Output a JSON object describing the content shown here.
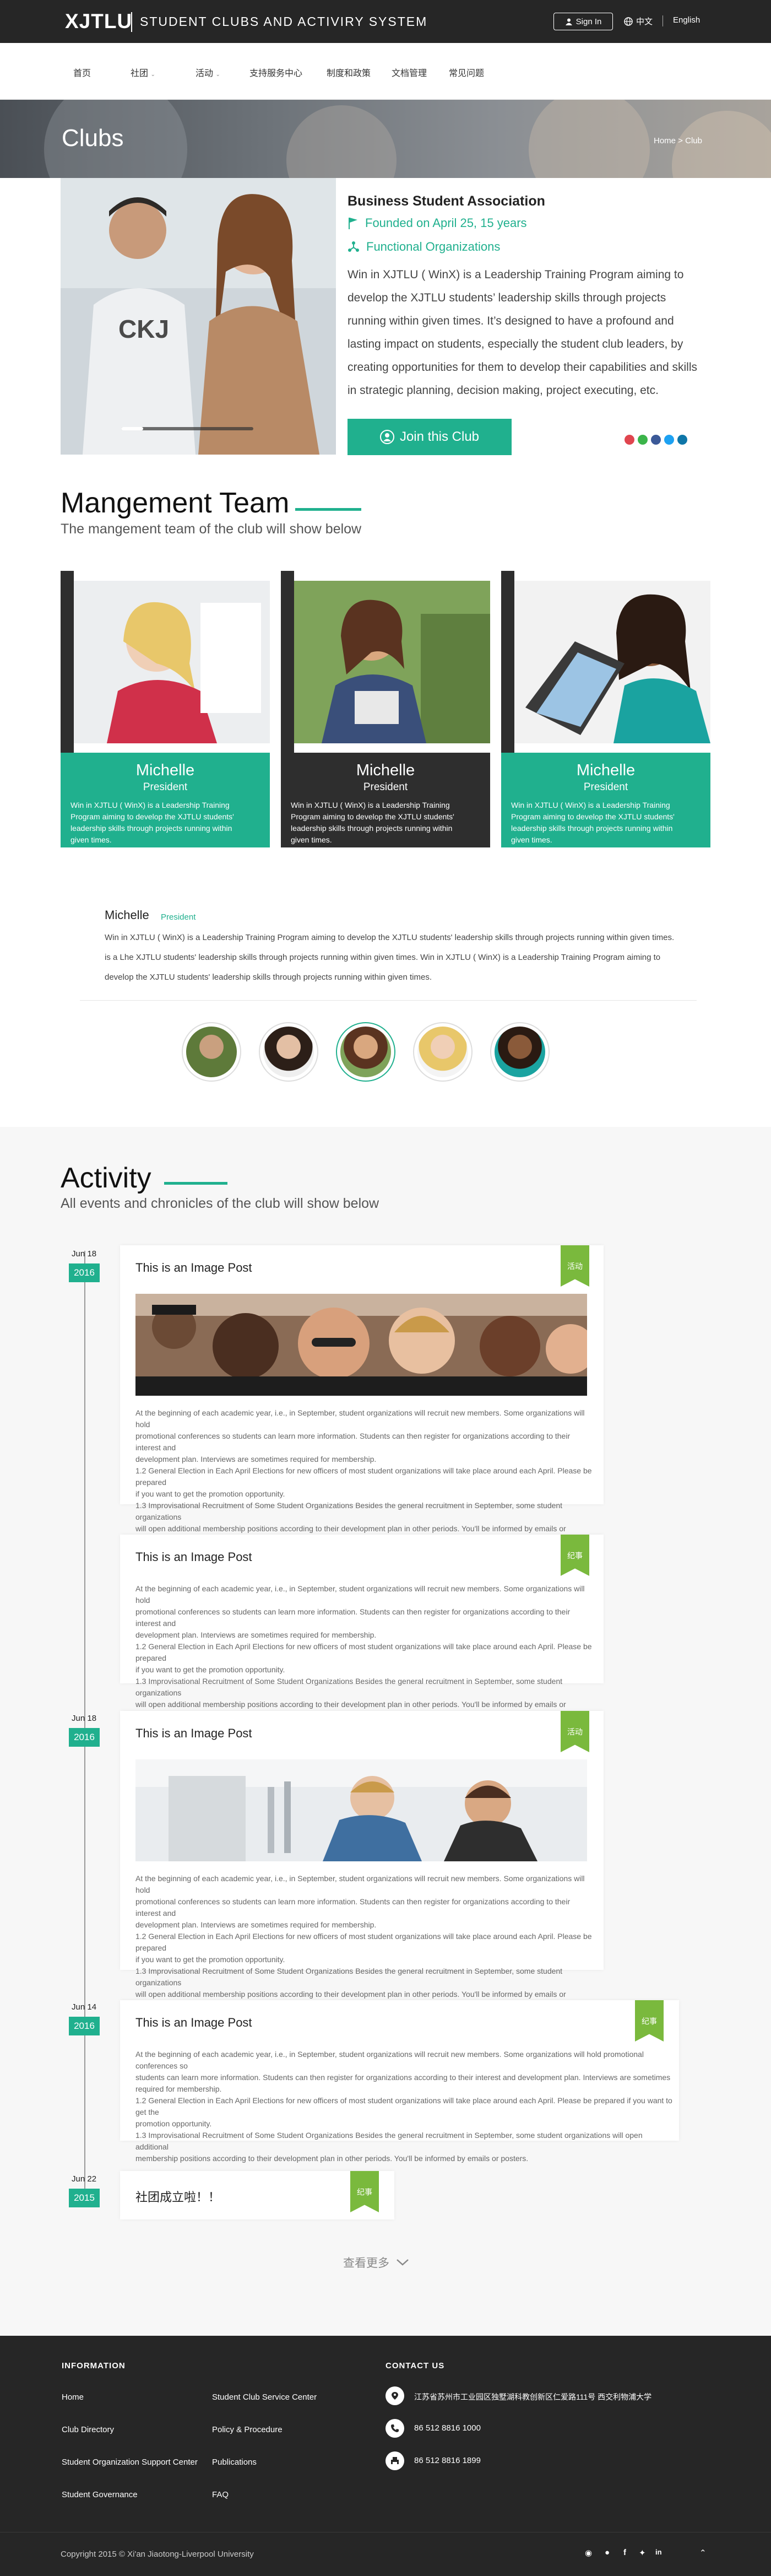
{
  "header": {
    "logo": "XJTLU",
    "system_title": "STUDENT CLUBS AND ACTIVIRY SYSTEM",
    "signin_label": "Sign In",
    "lang_zh": "中文",
    "lang_en": "English"
  },
  "nav": [
    "首页",
    "社团",
    "活动",
    "支持服务中心",
    "制度和政策",
    "文档管理",
    "常见问题"
  ],
  "hero": {
    "title": "Clubs",
    "breadcrumb": "Home > Club"
  },
  "club": {
    "name": "Business Student Association",
    "founded": "Founded on April 25, 15 years",
    "category": "Functional Organizations",
    "description": "Win in XJTLU ( WinX) is a Leadership Training Program aiming to develop the XJTLU students’ leadership skills through projects running within given times. It’s designed to have a profound and lasting impact on students, especially the student club leaders, by creating opportunities for them to develop their capabilities and skills in strategic planning, decision making, project executing, etc.",
    "join_label": "Join this Club"
  },
  "team": {
    "title": "Mangement Team",
    "subtitle": "The mangement team of the club will show below",
    "members": [
      {
        "name": "Michelle",
        "role": "President",
        "text": "Win in XJTLU ( WinX) is a Leadership Training Program aiming to develop the XJTLU students' leadership skills through projects running within given times."
      },
      {
        "name": "Michelle",
        "role": "President",
        "text": "Win in XJTLU ( WinX) is a Leadership Training Program aiming to develop the XJTLU students' leadership skills through projects running within given times."
      },
      {
        "name": "Michelle",
        "role": "President",
        "text": "Win in XJTLU ( WinX) is a Leadership Training Program aiming to develop the XJTLU students' leadership skills through projects running within given times."
      }
    ],
    "detail": {
      "name": "Michelle",
      "role": "President",
      "lines": [
        "Win in XJTLU ( WinX) is a Leadership Training Program aiming to develop the XJTLU students' leadership skills through projects running within given times.",
        "is a Lhe XJTLU students' leadership skills through projects running within given times. Win in XJTLU ( WinX) is a Leadership Training Program aiming to",
        "develop the XJTLU students' leadership skills through projects running within given times."
      ]
    }
  },
  "activity": {
    "title": "Activity",
    "subtitle": "All events and chronicles of the club will show below",
    "entries": [
      {
        "date": "Jun 18",
        "year": "2016",
        "title": "This is an Image Post",
        "tag": "活动",
        "text": [
          "At the beginning of each academic year, i.e., in September, student organizations will recruit new members. Some organizations will hold",
          "promotional conferences so students can learn more information. Students can then register for organizations according to their interest and",
          "development plan. Interviews are sometimes required for membership.",
          "1.2 General Election in Each April Elections for new officers of most student organizations will take place around each April. Please be prepared",
          "if you want to get the promotion opportunity.",
          "1.3 Improvisational Recruitment of Some Student Organizations Besides the general recruitment in September, some student organizations",
          "will open additional membership positions according to their development plan in other periods. You'll be informed by emails or posters."
        ]
      },
      {
        "date": "",
        "year": "",
        "title": "This is an Image Post",
        "tag": "纪事",
        "text": [
          "At the beginning of each academic year, i.e., in September, student organizations will recruit new members. Some organizations will hold",
          "promotional conferences so students can learn more information. Students can then register for organizations according to their interest and",
          "development plan. Interviews are sometimes required for membership.",
          "1.2 General Election in Each April Elections for new officers of most student organizations will take place around each April. Please be prepared",
          "if you want to get the promotion opportunity.",
          "1.3 Improvisational Recruitment of Some Student Organizations Besides the general recruitment in September, some student organizations",
          "will open additional membership positions according to their development plan in other periods. You'll be informed by emails or posters."
        ]
      },
      {
        "date": "Jun 18",
        "year": "2016",
        "title": "This is an Image Post",
        "tag": "活动",
        "text": [
          "At the beginning of each academic year, i.e., in September, student organizations will recruit new members. Some organizations will hold",
          "promotional conferences so students can learn more information. Students can then register for organizations according to their interest and",
          "development plan. Interviews are sometimes required for membership.",
          "1.2 General Election in Each April Elections for new officers of most student organizations will take place around each April. Please be prepared",
          "if you want to get the promotion opportunity.",
          "1.3 Improvisational Recruitment of Some Student Organizations Besides the general recruitment in September, some student organizations",
          "will open additional membership positions according to their development plan in other periods. You'll be informed by emails or posters."
        ]
      },
      {
        "date": "Jun 14",
        "year": "2016",
        "title": "This is an Image Post",
        "tag": "纪事",
        "text": [
          "At the beginning of each academic year, i.e., in September, student organizations will recruit new members. Some organizations will hold promotional conferences so",
          "students can learn more information. Students can then register for organizations according to their interest and development plan. Interviews are sometimes",
          "required for membership.",
          "1.2 General Election in Each April Elections for new officers of most student organizations will take place around each April. Please be prepared if you want to get the",
          "promotion opportunity.",
          "1.3 Improvisational Recruitment of Some Student Organizations Besides the general recruitment in September, some student organizations will open additional",
          "membership positions according to their development plan in other periods. You'll be informed by emails or posters."
        ]
      },
      {
        "date": "Jun 22",
        "year": "2015",
        "title": "社团成立啦！！",
        "tag": "纪事",
        "text": []
      }
    ],
    "more_label": "查看更多"
  },
  "footer": {
    "info_title": "INFORMATION",
    "links_col1": [
      "Home",
      "Club Directory",
      "Student Organization Support Center",
      "Student Governance"
    ],
    "links_col2": [
      "Student Club Service Center",
      "Policy & Procedure",
      "Publications",
      "FAQ"
    ],
    "contact_title": "CONTACT US",
    "address": "江苏省苏州市工业园区独墅湖科教创新区仁爱路111号 西交利物浦大学",
    "phone": "86 512 8816 1000",
    "fax": "86 512 8816 1899",
    "copyright": "Copyright 2015 © Xi'an Jiaotong-Liverpool University"
  },
  "colors": {
    "accent": "#20b08e",
    "dark": "#262626",
    "tag": "#7ab93d"
  }
}
